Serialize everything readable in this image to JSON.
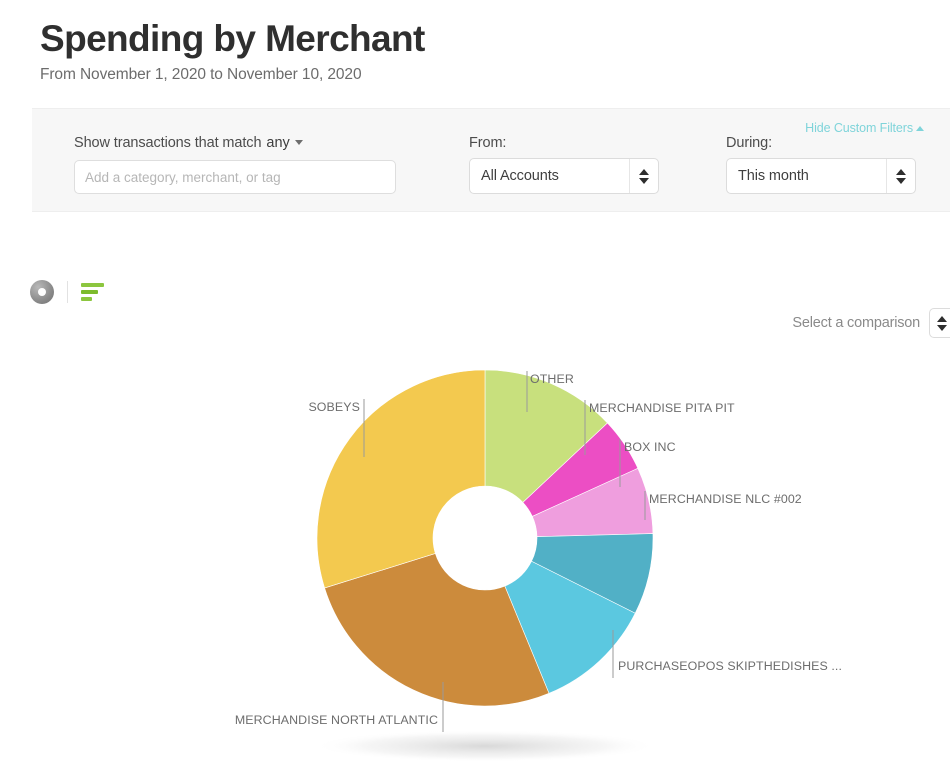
{
  "header": {
    "title": "Spending by Merchant",
    "subtitle": "From November 1, 2020 to November 10, 2020"
  },
  "filters": {
    "match_label": "Show transactions that match",
    "match_value": "any",
    "search_placeholder": "Add a category, merchant, or tag",
    "search_value": "",
    "from_label": "From:",
    "from_value": "All Accounts",
    "during_label": "During:",
    "during_value": "This month",
    "hide_filters_label": "Hide Custom Filters"
  },
  "toolbar": {
    "donut_view_icon": "donut-chart-icon",
    "bar_view_icon": "bar-chart-icon",
    "comparison_label": "Select a comparison"
  },
  "chart_data": {
    "type": "pie",
    "title": "Spending by Merchant",
    "variant": "donut",
    "legend": "callout-labels",
    "grid": false,
    "units": "percent of total spending",
    "categories": [
      "OTHER",
      "MERCHANDISE PITA PIT",
      "BOX INC",
      "MERCHANDISE NLC #002",
      "PURCHASEOPOS SKIPTHEDISHES ...",
      "MERCHANDISE NORTH ATLANTIC",
      "SOBEYS"
    ],
    "values": [
      13.0,
      5.2,
      6.4,
      7.8,
      11.4,
      26.4,
      29.8
    ],
    "colors": [
      "#c8e07d",
      "#ec4ec4",
      "#ef9ede",
      "#51b0c6",
      "#5bc8e0",
      "#cc8b3c",
      "#f3c94f"
    ],
    "slices": [
      {
        "label": "OTHER",
        "value": 13.0,
        "color": "#c8e07d",
        "start_angle": 0,
        "end_angle": 46.8
      },
      {
        "label": "MERCHANDISE PITA PIT",
        "value": 5.2,
        "color": "#ec4ec4",
        "start_angle": 46.8,
        "end_angle": 65.5
      },
      {
        "label": "BOX INC",
        "value": 6.4,
        "color": "#ef9ede",
        "start_angle": 65.5,
        "end_angle": 88.5
      },
      {
        "label": "MERCHANDISE NLC #002",
        "value": 7.8,
        "color": "#51b0c6",
        "start_angle": 88.5,
        "end_angle": 116.6
      },
      {
        "label": "PURCHASEOPOS SKIPTHEDISHES ...",
        "value": 11.4,
        "color": "#5bc8e0",
        "start_angle": 116.6,
        "end_angle": 157.6
      },
      {
        "label": "MERCHANDISE NORTH ATLANTIC",
        "value": 26.4,
        "color": "#cc8b3c",
        "start_angle": 157.6,
        "end_angle": 252.7
      },
      {
        "label": "SOBEYS",
        "value": 29.8,
        "color": "#f3c94f",
        "start_angle": 252.7,
        "end_angle": 360
      }
    ]
  }
}
